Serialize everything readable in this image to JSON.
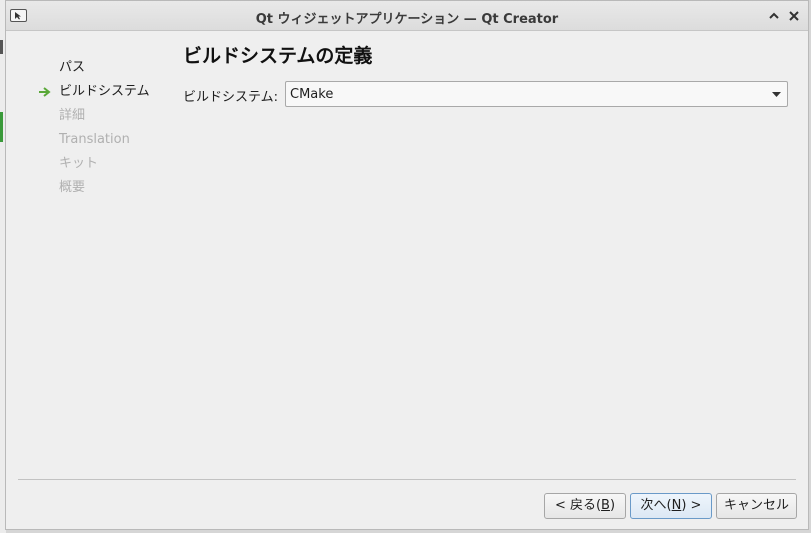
{
  "window": {
    "title": "Qt ウィジェットアプリケーション — Qt Creator"
  },
  "nav": {
    "items": [
      {
        "label": "パス",
        "state": "done"
      },
      {
        "label": "ビルドシステム",
        "state": "current"
      },
      {
        "label": "詳細",
        "state": "disabled"
      },
      {
        "label": "Translation",
        "state": "disabled"
      },
      {
        "label": "キット",
        "state": "disabled"
      },
      {
        "label": "概要",
        "state": "disabled"
      }
    ]
  },
  "page": {
    "title": "ビルドシステムの定義",
    "build_system_label": "ビルドシステム:",
    "build_system_value": "CMake"
  },
  "buttons": {
    "back": {
      "pre": "< 戻る(",
      "mnemonic": "B",
      "post": ")"
    },
    "next": {
      "pre": "次へ(",
      "mnemonic": "N",
      "post": ") >"
    },
    "cancel": "キャンセル"
  },
  "colors": {
    "accent_arrow": "#5aa838",
    "disabled_text": "#b0b0b0",
    "default_button_border": "#6a9ac8"
  },
  "icons": {
    "window": "window-icon",
    "minimize": "chevron-up-icon",
    "close": "close-icon",
    "current_step": "arrow-right-icon",
    "dropdown": "chevron-down-icon"
  }
}
